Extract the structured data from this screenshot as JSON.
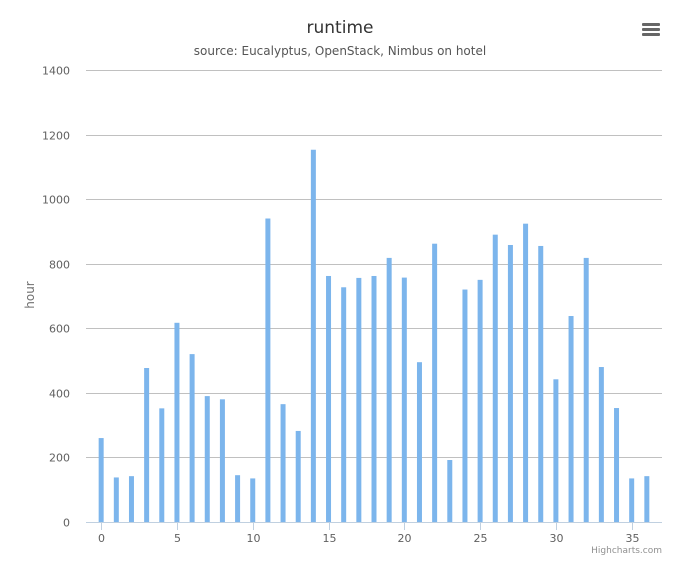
{
  "chart_data": {
    "type": "bar",
    "title": "runtime",
    "subtitle": "source: Eucalyptus, OpenStack, Nimbus on hotel",
    "xlabel": "",
    "ylabel": "hour",
    "x": [
      0,
      1,
      2,
      3,
      4,
      5,
      6,
      7,
      8,
      9,
      10,
      11,
      12,
      13,
      14,
      15,
      16,
      17,
      18,
      19,
      20,
      21,
      22,
      23,
      24,
      25,
      26,
      27,
      28,
      29,
      30,
      31,
      32,
      33,
      34,
      35,
      36
    ],
    "values": [
      260,
      138,
      142,
      477,
      352,
      617,
      520,
      390,
      380,
      145,
      135,
      940,
      365,
      282,
      1153,
      762,
      727,
      756,
      762,
      818,
      757,
      495,
      862,
      192,
      720,
      750,
      890,
      858,
      924,
      855,
      442,
      638,
      818,
      480,
      353,
      135,
      142
    ],
    "xlim": [
      -1,
      37
    ],
    "xticks": [
      0,
      5,
      10,
      15,
      20,
      25,
      30,
      35
    ],
    "ylim": [
      0,
      1400
    ],
    "yticks": [
      0,
      200,
      400,
      600,
      800,
      1000,
      1200,
      1400
    ],
    "grid": true,
    "legend": "none",
    "bar_color": "#7cb5ec",
    "grid_color": "#c0c0c0",
    "credits": "Highcharts.com"
  },
  "toolbar": {
    "menu_icon": "hamburger-menu-icon"
  }
}
